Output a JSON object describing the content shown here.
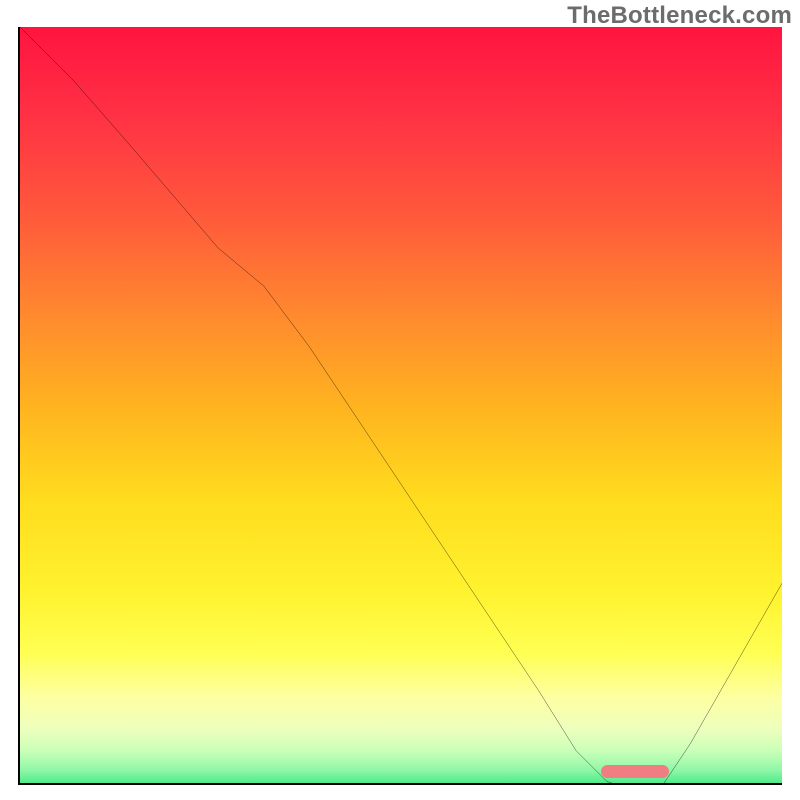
{
  "watermark": "TheBottleneck.com",
  "colors": {
    "axis": "#000000",
    "curve": "#000000",
    "marker": "#ef7d82",
    "gradient_stops": [
      {
        "offset": 0.0,
        "color": "#ff1440"
      },
      {
        "offset": 0.12,
        "color": "#ff3244"
      },
      {
        "offset": 0.25,
        "color": "#ff5a3b"
      },
      {
        "offset": 0.38,
        "color": "#ff8a2e"
      },
      {
        "offset": 0.5,
        "color": "#ffb41f"
      },
      {
        "offset": 0.62,
        "color": "#ffdc1e"
      },
      {
        "offset": 0.74,
        "color": "#fff22e"
      },
      {
        "offset": 0.82,
        "color": "#ffff52"
      },
      {
        "offset": 0.88,
        "color": "#fdffa2"
      },
      {
        "offset": 0.92,
        "color": "#eeffbc"
      },
      {
        "offset": 0.95,
        "color": "#caffb8"
      },
      {
        "offset": 0.975,
        "color": "#90f7a8"
      },
      {
        "offset": 1.0,
        "color": "#34e77d"
      }
    ]
  },
  "chart_data": {
    "type": "line",
    "title": "",
    "xlabel": "",
    "ylabel": "",
    "xlim": [
      0,
      100
    ],
    "ylim": [
      0,
      100
    ],
    "grid": false,
    "series": [
      {
        "name": "bottleneck-curve",
        "x": [
          0,
          7,
          14,
          20,
          26,
          32,
          38,
          44,
          50,
          56,
          62,
          68,
          73,
          77,
          80,
          84,
          88,
          92,
          96,
          100
        ],
        "y": [
          100,
          93,
          85,
          78,
          71,
          66,
          58,
          49,
          40,
          31,
          22,
          13,
          5,
          1,
          0,
          0,
          6,
          13,
          20,
          27
        ]
      }
    ],
    "annotations": [
      {
        "name": "optimal-marker",
        "x_start": 76,
        "x_end": 85,
        "y": 0.6
      }
    ]
  }
}
